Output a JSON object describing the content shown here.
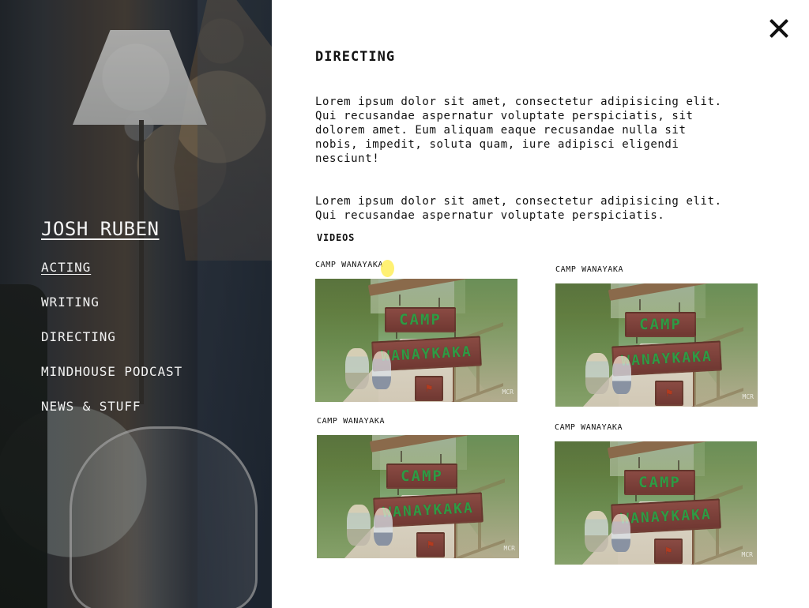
{
  "brand": {
    "name": "JOSH RUBEN"
  },
  "nav": {
    "items": [
      {
        "label": "ACTING",
        "active": true
      },
      {
        "label": "WRITING",
        "active": false
      },
      {
        "label": "DIRECTING",
        "active": false
      },
      {
        "label": "MINDHOUSE PODCAST",
        "active": false
      },
      {
        "label": "NEWS & STUFF",
        "active": false
      }
    ]
  },
  "header": {
    "close_icon": "close-icon"
  },
  "section": {
    "title": "DIRECTING",
    "paragraphs": [
      "Lorem ipsum dolor sit amet, consectetur adipisicing elit.\nQui recusandae aspernatur voluptate perspiciatis, sit\ndolorem amet. Eum aliquam eaque recusandae nulla sit\nnobis, impedit, soluta quam, iure adipisci eligendi\nnesciunt!",
      "Lorem ipsum dolor sit amet, consectetur adipisicing elit.\nQui recusandae aspernatur voluptate perspiciatis."
    ]
  },
  "videos": {
    "title": "VIDEOS",
    "items": [
      {
        "label": "CAMP WANAYAKA",
        "sign_top": "CAMP",
        "sign_mid": "WANAYKAKA",
        "watermark": "MCR"
      },
      {
        "label": "CAMP WANAYAKA",
        "sign_top": "CAMP",
        "sign_mid": "WANAYKAKA",
        "watermark": "MCR"
      },
      {
        "label": "CAMP WANAYAKA",
        "sign_top": "CAMP",
        "sign_mid": "WANAYKAKA",
        "watermark": "MCR"
      },
      {
        "label": "CAMP WANAYAKA",
        "sign_top": "CAMP",
        "sign_mid": "WANAYKAKA",
        "watermark": "MCR"
      }
    ]
  },
  "colors": {
    "text": "#111111",
    "nav_text": "#f2f2f2",
    "background": "#ffffff",
    "cursor_highlight": "#ffee5a"
  }
}
